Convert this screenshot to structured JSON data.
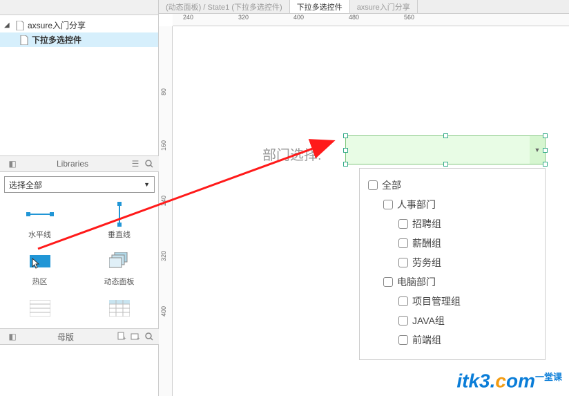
{
  "tree": {
    "root": "axsure入门分享",
    "child": "下拉多选控件"
  },
  "libraries": {
    "title": "Libraries",
    "select_label": "选择全部",
    "widgets": [
      {
        "label": "水平线",
        "name": "widget-hline"
      },
      {
        "label": "垂直线",
        "name": "widget-vline"
      },
      {
        "label": "热区",
        "name": "widget-hotspot"
      },
      {
        "label": "动态面板",
        "name": "widget-dynamic-panel"
      }
    ]
  },
  "masters": {
    "title": "母版"
  },
  "tabs": {
    "t1": "(动态面板) / State1 (下拉多选控件)",
    "t2": "下拉多选控件",
    "t3": "axsure入门分享"
  },
  "ruler_h": [
    "240",
    "320",
    "400",
    "480",
    "560"
  ],
  "ruler_v": [
    "80",
    "160",
    "240",
    "320",
    "400"
  ],
  "canvas": {
    "dept_label": "部门选择:",
    "dropdown": [
      {
        "text": "全部",
        "indent": 0
      },
      {
        "text": "人事部门",
        "indent": 1
      },
      {
        "text": "招聘组",
        "indent": 2
      },
      {
        "text": "薪酬组",
        "indent": 2
      },
      {
        "text": "劳务组",
        "indent": 2
      },
      {
        "text": "电脑部门",
        "indent": 1
      },
      {
        "text": "项目管理组",
        "indent": 2
      },
      {
        "text": "JAVA组",
        "indent": 2
      },
      {
        "text": "前端组",
        "indent": 2
      }
    ]
  },
  "watermark": {
    "brand": "itk3",
    "dot": ".",
    "c": "c",
    "om": "om",
    "sub": "一堂课"
  }
}
